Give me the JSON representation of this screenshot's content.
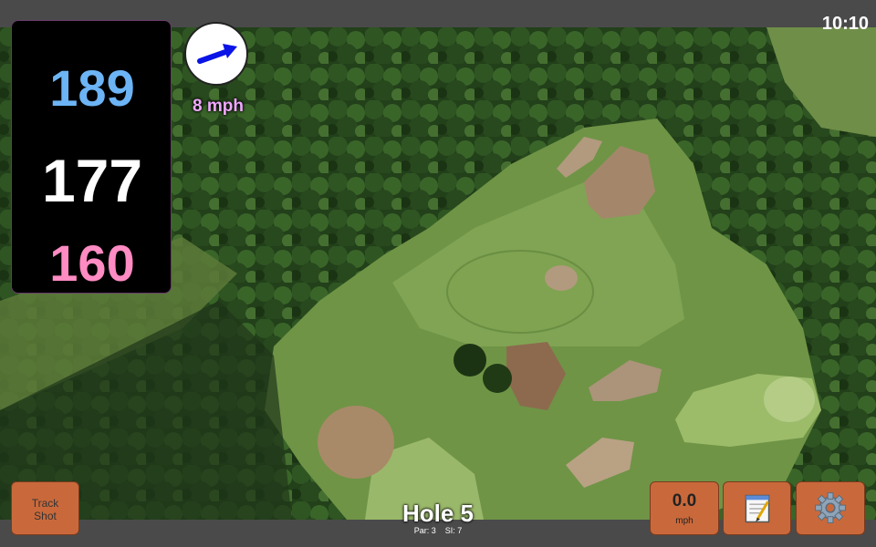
{
  "status": {
    "time": "10:10"
  },
  "yardages": {
    "back": "189",
    "middle": "177",
    "front": "160"
  },
  "wind": {
    "speed_label": "8 mph",
    "arrow_color": "#0a14e6",
    "icon": "wind-direction-arrow-icon"
  },
  "buttons": {
    "track_shot_label": "Track\nShot",
    "wind_value": "0.0",
    "wind_unit": "mph",
    "notes_icon": "notepad-icon",
    "settings_icon": "gear-icon"
  },
  "hole": {
    "title": "Hole 5",
    "par_label": "Par: 3",
    "si_label": "SI: 7"
  },
  "colors": {
    "back_yardage": "#6cb4f5",
    "middle_yardage": "#ffffff",
    "front_yardage": "#ff8bc3",
    "button": "#c9693b"
  }
}
